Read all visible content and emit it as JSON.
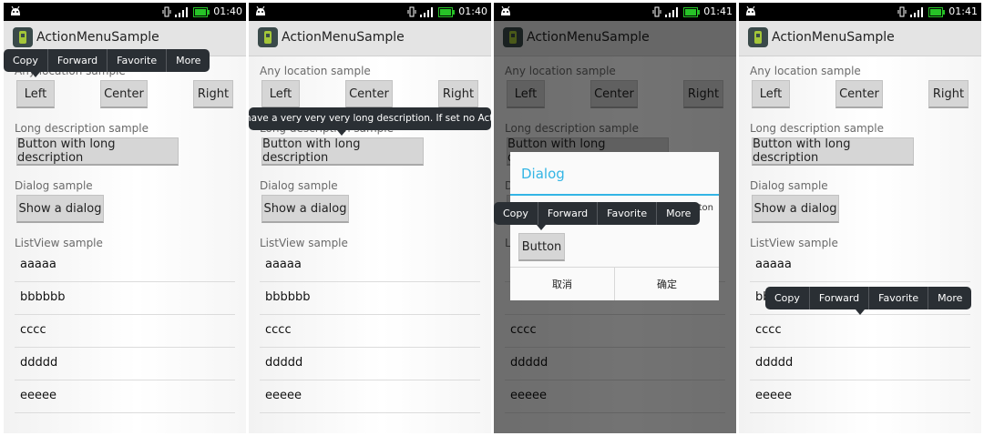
{
  "status": {
    "times": [
      "01:40",
      "01:40",
      "01:41",
      "01:41"
    ]
  },
  "app": {
    "title": "ActionMenuSample"
  },
  "sections": {
    "any_location": "Any location sample",
    "long_description": "Long description sample",
    "dialog": "Dialog sample",
    "listview": "ListView sample"
  },
  "buttons": {
    "left": "Left",
    "center": "Center",
    "right": "Right",
    "long_desc": "Button with long description",
    "show_dialog": "Show a dialog"
  },
  "list": [
    "aaaaa",
    "bbbbbb",
    "cccc",
    "ddddd",
    "eeeee"
  ],
  "menu": {
    "copy": "Copy",
    "forward": "Forward",
    "favorite": "Favorite",
    "more": "More"
  },
  "tooltip": "have a very very very long description. If set no Action",
  "dialog": {
    "title": "Dialog",
    "button": "Button",
    "snippet": "button",
    "cancel": "取消",
    "ok": "确定"
  },
  "colors": {
    "accent": "#33b5e5",
    "menu_bg": "#2a2f34",
    "battery": "#27c327"
  }
}
